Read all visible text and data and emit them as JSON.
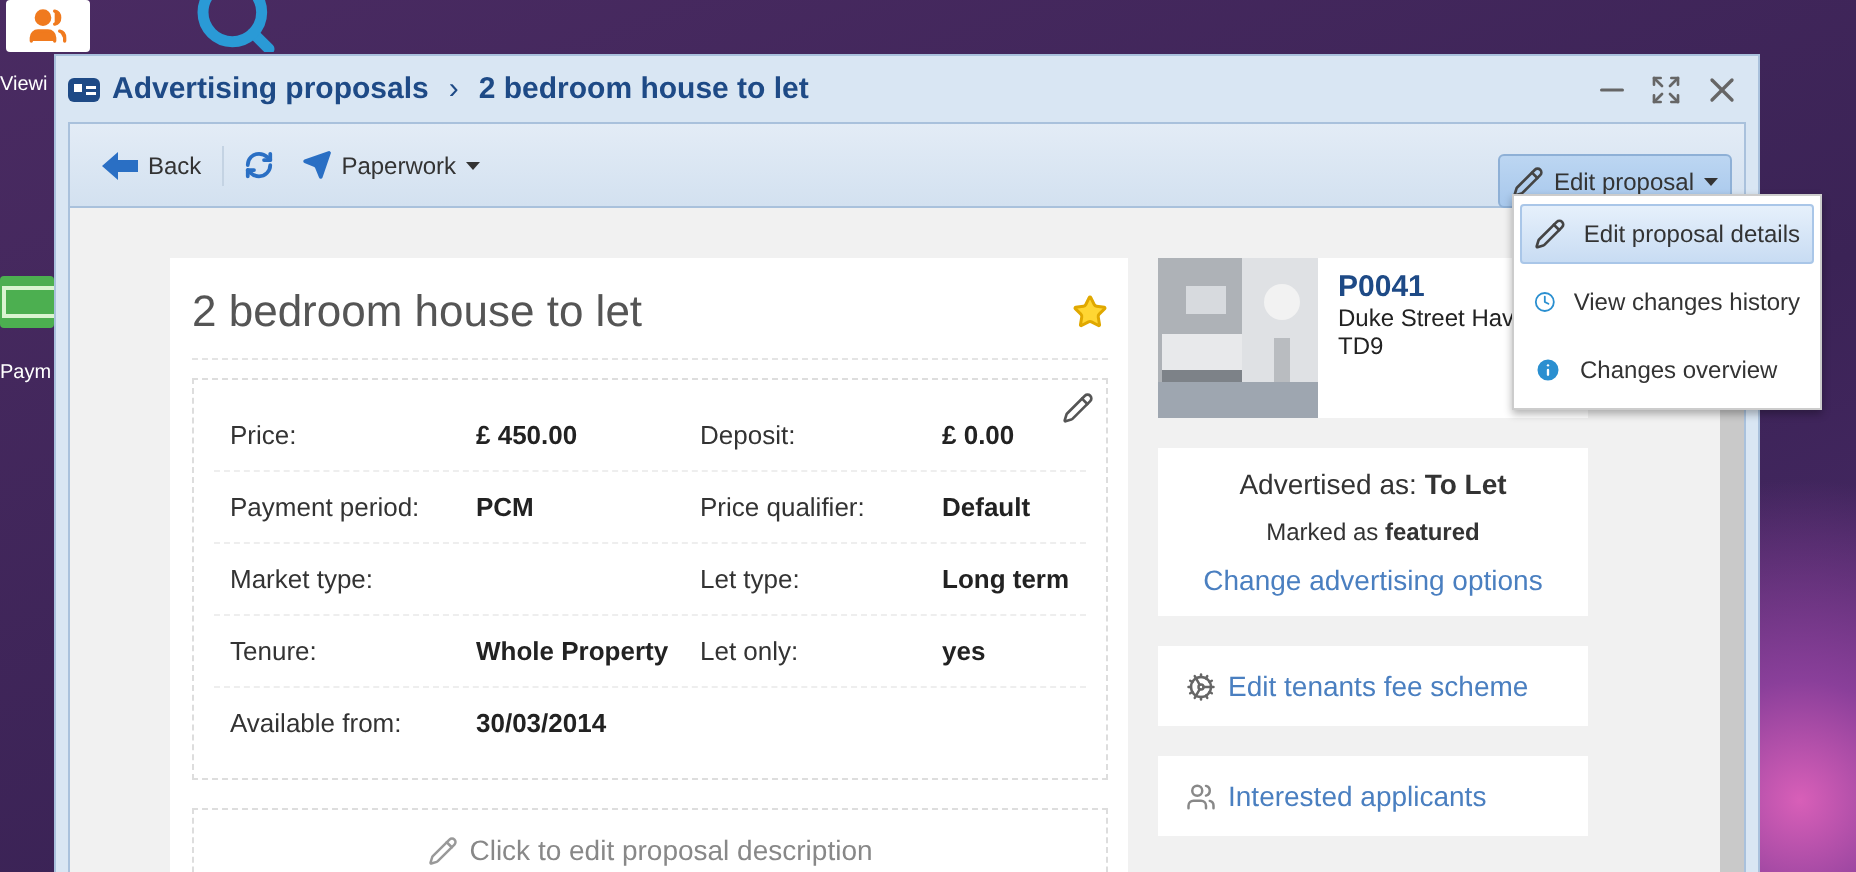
{
  "desktop_icons": [
    {
      "kind": "people",
      "label": "Viewi"
    },
    {
      "kind": "search"
    },
    {
      "kind": "payments",
      "label": "Paym"
    }
  ],
  "window": {
    "breadcrumb": [
      "Advertising proposals",
      "2 bedroom house to let"
    ],
    "separator": "›"
  },
  "toolbar": {
    "back": "Back",
    "paperwork": "Paperwork",
    "edit_proposal": "Edit proposal",
    "menu_open": true
  },
  "menu": [
    {
      "kind": "pencil",
      "label": "Edit proposal details",
      "selected": true
    },
    {
      "kind": "clock",
      "label": "View changes history",
      "selected": false
    },
    {
      "kind": "info",
      "label": "Changes overview",
      "selected": false
    }
  ],
  "proposal": {
    "title": "2 bedroom house to let",
    "starred": true,
    "details": [
      {
        "label": "Price:",
        "value": "£ 450.00",
        "label_2": "Deposit:",
        "value_2": "£ 0.00"
      },
      {
        "label": "Payment period:",
        "value": "PCM",
        "label_2": "Price qualifier:",
        "value_2": "Default"
      },
      {
        "label": "Market type:",
        "label_2": "Let type:",
        "value_2": "Long term"
      },
      {
        "label": "Tenure:",
        "value": "Whole Property",
        "label_2": "Let only:",
        "value_2": "yes"
      },
      {
        "label": "Available from:",
        "value": "30/03/2014"
      }
    ],
    "description_prompt": "Click to edit proposal description"
  },
  "property": {
    "ref": "P0041",
    "address": [
      "Duke Street Hav",
      "TD9"
    ]
  },
  "advertising": {
    "advertised_as": "Advertised as: **To Let**",
    "marked": "Marked as **featured**",
    "link": "Change advertising options"
  },
  "links": [
    {
      "kind": "fee",
      "label": "Edit tenants fee scheme"
    },
    {
      "kind": "people",
      "label": "Interested applicants"
    }
  ]
}
